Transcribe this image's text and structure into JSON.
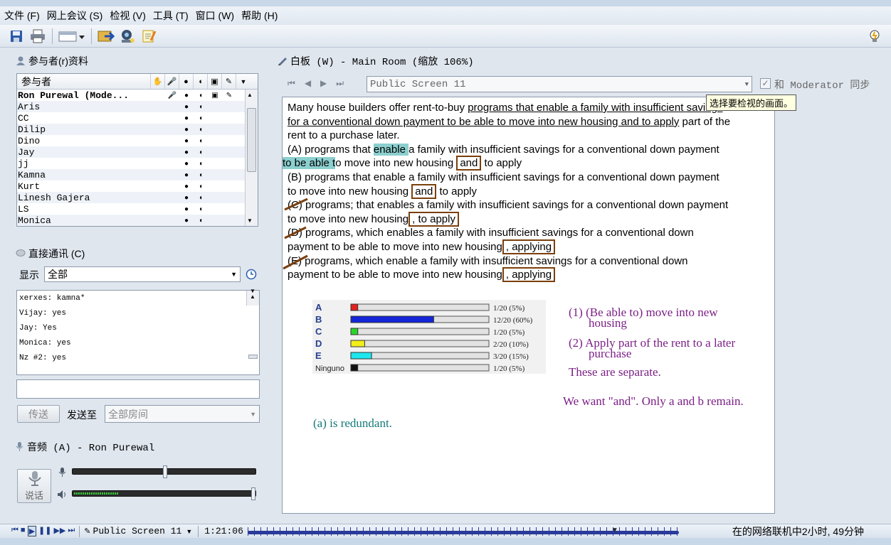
{
  "menu": [
    "文件 (F)",
    "网上会议 (S)",
    "检视 (V)",
    "工具 (T)",
    "窗口 (W)",
    "帮助 (H)"
  ],
  "participants_panel": {
    "title": "参与者(r)资料",
    "column_header": "参与者",
    "rows": [
      "Ron Purewal (Mode...",
      "Aris",
      "CC",
      "Dilip",
      "Dino",
      "Jay",
      "jj",
      "Kamna",
      "Kurt",
      "Linesh Gajera",
      "LS",
      "Monica"
    ]
  },
  "chat_panel": {
    "title": "直接通讯 (C)",
    "show_label": "显示",
    "show_value": "全部",
    "messages": [
      "xerxes: kamna*",
      "Vijay: yes",
      "Jay: Yes",
      "Monica: yes",
      "Nz #2: yes"
    ],
    "input_value": "",
    "send_label": "传送",
    "send_to_label": "发送至",
    "send_to_value": "全部房间"
  },
  "audio_panel": {
    "title": "音频 (A) - Ron Purewal",
    "talk_label": "说话",
    "mic_level": 0.5,
    "speaker_level": 1.0
  },
  "whiteboard": {
    "title": "白板 (W) - Main Room (缩放 106%)",
    "screen_select": "Public Screen 11",
    "sync_label": "和 Moderator 同步",
    "sync_checked": true,
    "tooltip": "选择要检视的画面。",
    "question_l1a": "Many house builders offer rent-to-buy ",
    "question_l1b": "programs that enable a family with insufficient savings",
    "question_l2a": "for a conventional down payment to be able to move into new housing and to apply",
    "question_l2b": " part of the",
    "question_l3": "rent to a purchase later.",
    "choice_a_1": "(A)  programs that ",
    "choice_a_hl1": "enable ",
    "choice_a_2": "a family with insufficient savings for a conventional down payment",
    "choice_a_hl2": "to be able t",
    "choice_a_3": "o move into new housing ",
    "choice_a_box": "and",
    "choice_a_4": " to apply",
    "choice_b_1": "(B)  programs that enable a family with insufficient savings for a conventional down payment",
    "choice_b_2": "to move into new housing ",
    "choice_b_box": "and",
    "choice_b_3": " to apply",
    "choice_c_1": "(C)  programs; that enables a family with insufficient savings for a conventional down payment",
    "choice_c_2": "to move into new housing",
    "choice_c_box": ", to apply",
    "choice_d_1": "(D)  programs, which enables a family with insufficient savings for a conventional down",
    "choice_d_2": "payment to be able to move into new housing",
    "choice_d_box": ", applying",
    "choice_e_1": "(E)  programs, which enable a family with insufficient savings for a conventional down",
    "choice_e_2": "payment to be able to move into new housing",
    "choice_e_box": ", applying",
    "note1_a": "(1) (Be able to) move into new",
    "note1_b": "housing",
    "note2_a": "(2) Apply part of the rent to a later",
    "note2_b": "purchase",
    "note3": "These are separate.",
    "note4": "We want \"and\".  Only a and b remain.",
    "note5": "(a) is redundant.",
    "note_color_purple": "#7b1f86",
    "note_color_teal": "#157a7a"
  },
  "chart_data": {
    "type": "bar",
    "categories": [
      "A",
      "B",
      "C",
      "D",
      "E",
      "Ninguno"
    ],
    "values": [
      5,
      60,
      5,
      10,
      15,
      5
    ],
    "labels": [
      "1/20 (5%)",
      "12/20 (60%)",
      "1/20 (5%)",
      "2/20 (10%)",
      "3/20 (15%)",
      "1/20 (5%)"
    ],
    "colors": [
      "#e32020",
      "#1426d8",
      "#2bd42b",
      "#f2ee1a",
      "#1ee7ee",
      "#111111"
    ],
    "xlim": [
      0,
      100
    ]
  },
  "status": {
    "screen": "Public Screen 11",
    "time": "1:21:06",
    "online": "在的网络联机中2小时, 49分钟",
    "progress": 0.86
  }
}
